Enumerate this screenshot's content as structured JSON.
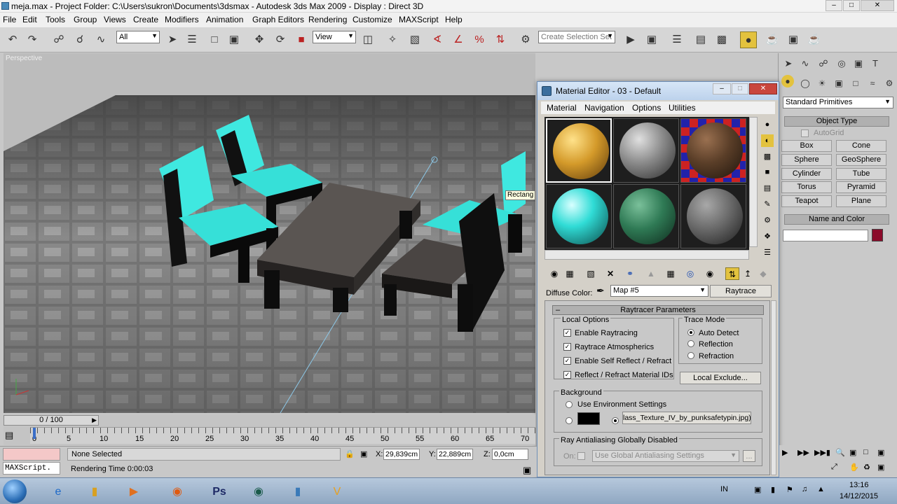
{
  "window": {
    "title": "meja.max   - Project Folder: C:\\Users\\sukron\\Documents\\3dsmax   - Autodesk 3ds Max  2009   - Display : Direct 3D",
    "minimize": "–",
    "maximize": "□",
    "close": "✕"
  },
  "menu": [
    "File",
    "Edit",
    "Tools",
    "Group",
    "Views",
    "Create",
    "Modifiers",
    "Animation",
    "Graph Editors",
    "Rendering",
    "Customize",
    "MAXScript",
    "Help"
  ],
  "toolbar": {
    "filter_value": "All",
    "refcoord_value": "View",
    "selection_set_placeholder": "Create Selection Set"
  },
  "viewport": {
    "label": "Perspective",
    "tooltip": "Rectang"
  },
  "command_panel": {
    "dropdown_value": "Standard Primitives",
    "object_type_header": "Object Type",
    "autogrid_label": "AutoGrid",
    "buttons": [
      "Box",
      "Cone",
      "Sphere",
      "GeoSphere",
      "Cylinder",
      "Tube",
      "Torus",
      "Pyramid",
      "Teapot",
      "Plane"
    ],
    "name_color_header": "Name and Color",
    "object_color": "#8b0a2a"
  },
  "material_editor": {
    "title": "Material Editor - 03 - Default",
    "menu": [
      "Material",
      "Navigation",
      "Options",
      "Utilities"
    ],
    "diffuse_label": "Diffuse Color:",
    "map_value": "Map #5",
    "map_type_button": "Raytrace",
    "rollout_title": "Raytracer Parameters",
    "local_options": {
      "title": "Local Options",
      "items": [
        "Enable Raytracing",
        "Raytrace Atmospherics",
        "Enable Self Reflect / Refract",
        "Reflect / Refract Material IDs"
      ]
    },
    "trace_mode": {
      "title": "Trace Mode",
      "options": [
        "Auto Detect",
        "Reflection",
        "Refraction"
      ],
      "selected": "Auto Detect"
    },
    "local_exclude_button": "Local Exclude...",
    "background": {
      "title": "Background",
      "use_env_label": "Use Environment Settings",
      "color_swatch": "#000000",
      "map_button": "lass_Texture_IV_by_punksafetypin.jpg)"
    },
    "antialias": {
      "title": "Ray Antialiasing Globally Disabled",
      "on_label": "On:",
      "select_value": "Use Global Antialiasing Settings",
      "more_button": "..."
    }
  },
  "timeline": {
    "frame_counter": "0 / 100",
    "ticks": [
      "0",
      "5",
      "10",
      "15",
      "20",
      "25",
      "30",
      "35",
      "40",
      "45",
      "50",
      "55",
      "60",
      "65",
      "70"
    ]
  },
  "status": {
    "maxscript_label": "MAXScript.",
    "selection": "None Selected",
    "x_label": "X:",
    "x_value": "29,839cm",
    "y_label": "Y:",
    "y_value": "22,889cm",
    "z_label": "Z:",
    "z_value": "0,0cm",
    "render_time": "Rendering Time  0:00:03"
  },
  "taskbar": {
    "language": "IN",
    "time": "13:16",
    "date": "14/12/2015"
  }
}
